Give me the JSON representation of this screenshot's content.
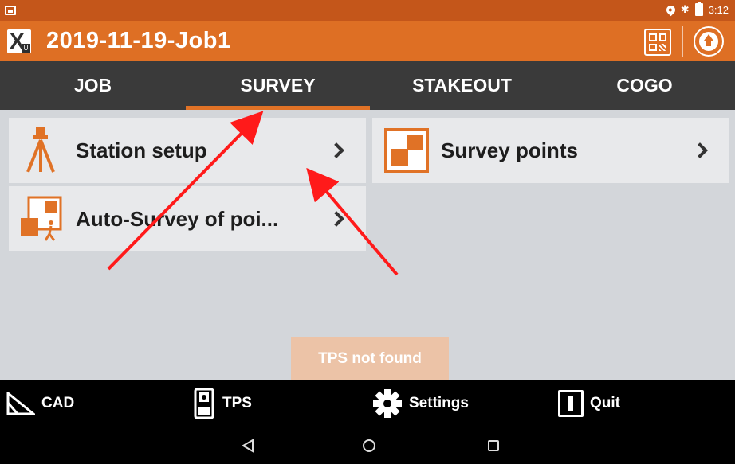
{
  "app": {
    "title": "2019-11-19-Job1",
    "status_time": "3:12",
    "accent_color": "#de6f24",
    "status_color": "#c4561a"
  },
  "tabs": [
    {
      "label": "JOB",
      "active": false
    },
    {
      "label": "SURVEY",
      "active": true
    },
    {
      "label": "STAKEOUT",
      "active": false
    },
    {
      "label": "COGO",
      "active": false
    }
  ],
  "menu": {
    "station_setup": {
      "label": "Station setup",
      "icon": "tripod-icon"
    },
    "survey_points": {
      "label": "Survey points",
      "icon": "survey-points-icon"
    },
    "auto_survey": {
      "label": "Auto-Survey of poi...",
      "icon": "auto-survey-icon"
    }
  },
  "toast": {
    "text": "TPS not found"
  },
  "bottom_bar": {
    "cad": "CAD",
    "tps": "TPS",
    "settings": "Settings",
    "quit": "Quit"
  },
  "icons": {
    "qr": "qr-code-icon",
    "upload": "upload-icon",
    "back": "back-icon",
    "home": "home-icon",
    "recent": "recent-apps-icon"
  }
}
